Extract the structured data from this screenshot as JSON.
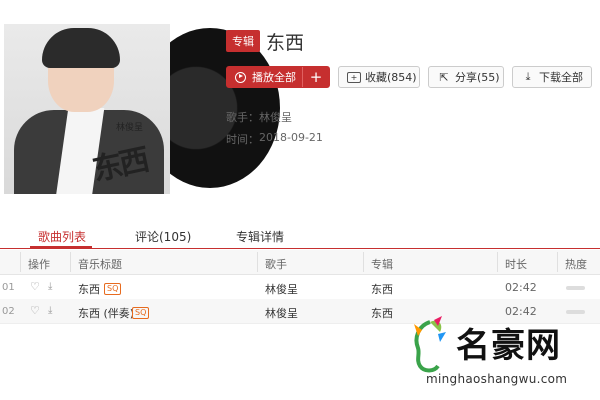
{
  "album": {
    "tag": "专辑",
    "title": "东西",
    "cover_signature": "东西",
    "cover_artist_mark": "林俊呈",
    "play_all_label": "播放全部",
    "add_label": "+",
    "collect_label": "收藏(854)",
    "share_label": "分享(55)",
    "download_label": "下载全部",
    "singer_key": "歌手：",
    "singer_value": "林俊呈",
    "time_key": "时间：",
    "time_value": "2018-09-21"
  },
  "tabs": [
    {
      "label": "歌曲列表",
      "active": true
    },
    {
      "label": "评论(105)",
      "active": false
    },
    {
      "label": "专辑详情",
      "active": false
    }
  ],
  "table": {
    "headers": [
      "操作",
      "音乐标题",
      "歌手",
      "专辑",
      "时长",
      "热度"
    ],
    "rows": [
      {
        "index": "01",
        "title": "东西",
        "badge": "SQ",
        "singer": "林俊呈",
        "album": "东西",
        "duration": "02:42",
        "heat": 0.6
      },
      {
        "index": "02",
        "title": "东西 (伴奏)",
        "badge": "SQ",
        "singer": "林俊呈",
        "album": "东西",
        "duration": "02:42",
        "heat": 0.6
      }
    ]
  },
  "watermark": {
    "name": "名豪网",
    "url": "minghaoshangwu.com"
  },
  "colors": {
    "accent": "#c62f2f",
    "badge": "#e76b1f"
  }
}
